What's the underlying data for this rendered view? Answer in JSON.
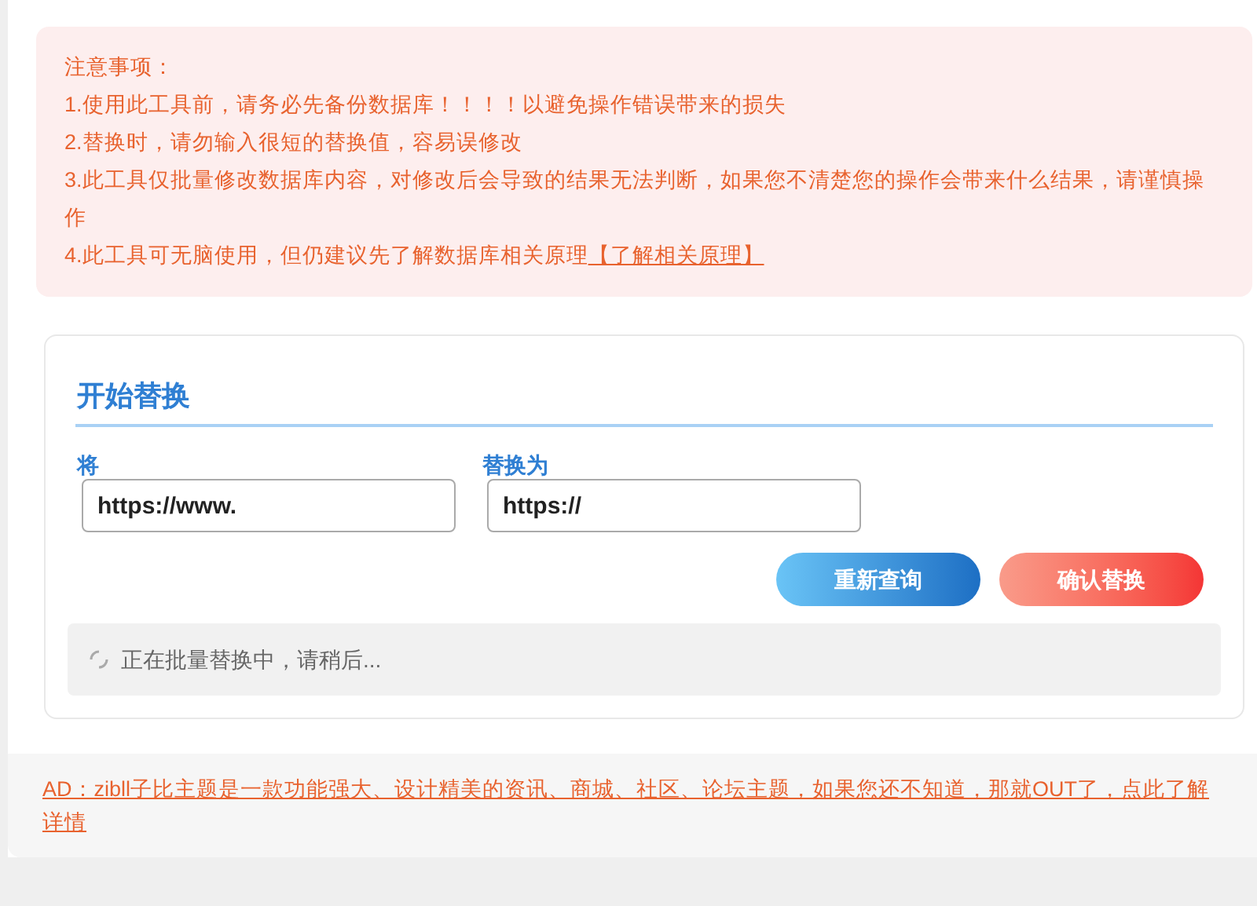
{
  "notice": {
    "title": "注意事项：",
    "items": [
      {
        "text": "1.使用此工具前，请务必先备份数据库！！！！以避免操作错误带来的损失"
      },
      {
        "text": "2.替换时，请勿输入很短的替换值，容易误修改"
      },
      {
        "text": "3.此工具仅批量修改数据库内容，对修改后会导致的结果无法判断，如果您不清楚您的操作会带来什么结果，请谨慎操作"
      },
      {
        "text": "4.此工具可无脑使用，但仍建议先了解数据库相关原理",
        "link": "【了解相关原理】"
      }
    ]
  },
  "replace": {
    "title": "开始替换",
    "fields": [
      {
        "label": "将",
        "value": "https://www."
      },
      {
        "label": "替换为",
        "value": "https://"
      }
    ],
    "buttons": [
      {
        "label": "重新查询",
        "kind": "query"
      },
      {
        "label": "确认替换",
        "kind": "confirm"
      }
    ],
    "status": "正在批量替换中，请稍后..."
  },
  "ad": "AD：zibll子比主题是一款功能强大、设计精美的资讯、商城、社区、论坛主题，如果您还不知道，那就OUT了，点此了解详情"
}
